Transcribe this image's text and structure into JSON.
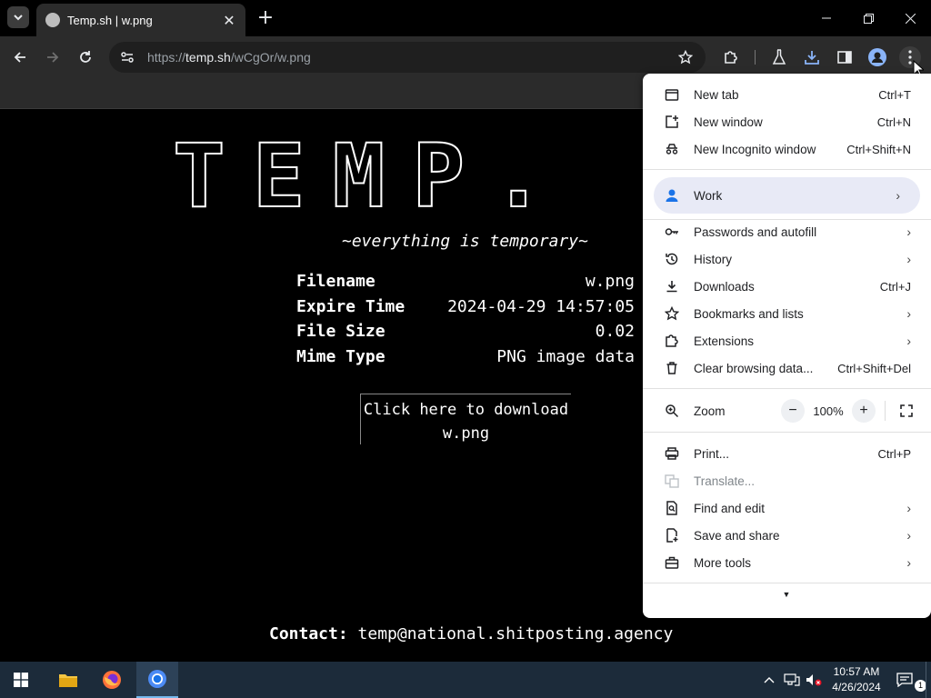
{
  "browser": {
    "tab_title": "Temp.sh | w.png",
    "url_prefix": "https://",
    "url_host": "temp.sh",
    "url_path": "/wCgOr/w.png"
  },
  "page": {
    "logo_text": "TEMP.",
    "tagline": "~everything is temporary~",
    "info": [
      {
        "key": "Filename",
        "value": "w.png"
      },
      {
        "key": "Expire Time",
        "value": "2024-04-29 14:57:05"
      },
      {
        "key": "File Size",
        "value": "0.02"
      },
      {
        "key": "Mime Type",
        "value": "PNG image data"
      }
    ],
    "download_line1": "Click here to download",
    "download_line2": "w.png",
    "contact_label": "Contact:",
    "contact_email": "temp@national.shitposting.agency"
  },
  "menu": {
    "new_tab": {
      "label": "New tab",
      "shortcut": "Ctrl+T"
    },
    "new_window": {
      "label": "New window",
      "shortcut": "Ctrl+N"
    },
    "incognito": {
      "label": "New Incognito window",
      "shortcut": "Ctrl+Shift+N"
    },
    "profile": {
      "label": "Work"
    },
    "passwords": {
      "label": "Passwords and autofill"
    },
    "history": {
      "label": "History"
    },
    "downloads": {
      "label": "Downloads",
      "shortcut": "Ctrl+J"
    },
    "bookmarks": {
      "label": "Bookmarks and lists"
    },
    "extensions": {
      "label": "Extensions"
    },
    "clear": {
      "label": "Clear browsing data...",
      "shortcut": "Ctrl+Shift+Del"
    },
    "zoom": {
      "label": "Zoom",
      "value": "100%",
      "minus": "−",
      "plus": "+"
    },
    "print": {
      "label": "Print...",
      "shortcut": "Ctrl+P"
    },
    "translate": {
      "label": "Translate..."
    },
    "find": {
      "label": "Find and edit"
    },
    "save": {
      "label": "Save and share"
    },
    "more_tools": {
      "label": "More tools"
    }
  },
  "taskbar": {
    "time": "10:57 AM",
    "date": "4/26/2024",
    "notification_count": "1"
  },
  "colors": {
    "accent_blue": "#1a73e8",
    "profile_highlight": "#e8eaf6",
    "taskbar_bg": "#1c2b3a"
  }
}
